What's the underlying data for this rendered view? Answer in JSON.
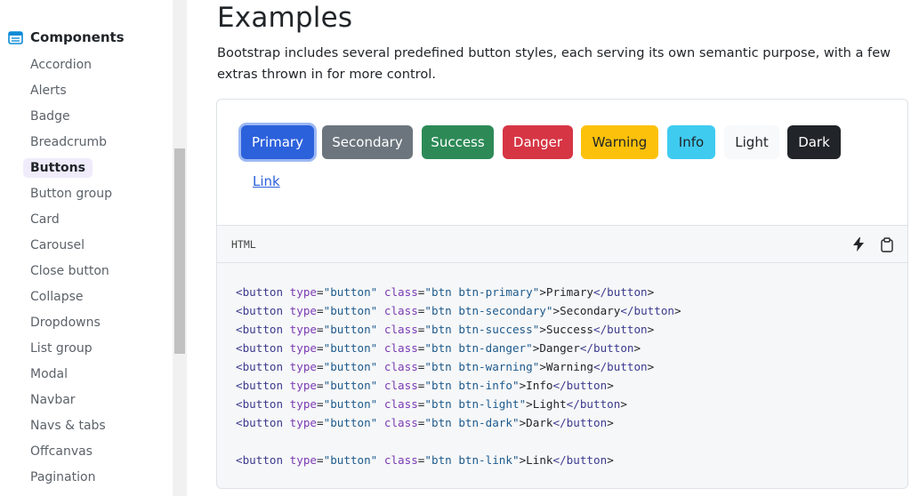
{
  "sidebar": {
    "section_title": "Components",
    "section_icon": "list-window-icon",
    "items": [
      {
        "label": "Accordion",
        "active": false
      },
      {
        "label": "Alerts",
        "active": false
      },
      {
        "label": "Badge",
        "active": false
      },
      {
        "label": "Breadcrumb",
        "active": false
      },
      {
        "label": "Buttons",
        "active": true
      },
      {
        "label": "Button group",
        "active": false
      },
      {
        "label": "Card",
        "active": false
      },
      {
        "label": "Carousel",
        "active": false
      },
      {
        "label": "Close button",
        "active": false
      },
      {
        "label": "Collapse",
        "active": false
      },
      {
        "label": "Dropdowns",
        "active": false
      },
      {
        "label": "List group",
        "active": false
      },
      {
        "label": "Modal",
        "active": false
      },
      {
        "label": "Navbar",
        "active": false
      },
      {
        "label": "Navs & tabs",
        "active": false
      },
      {
        "label": "Offcanvas",
        "active": false
      },
      {
        "label": "Pagination",
        "active": false
      }
    ]
  },
  "main": {
    "title": "Examples",
    "description": "Bootstrap includes several predefined button styles, each serving its own semantic purpose, with a few extras thrown in for more control."
  },
  "example": {
    "buttons": {
      "primary": "Primary",
      "secondary": "Secondary",
      "success": "Success",
      "danger": "Danger",
      "warning": "Warning",
      "info": "Info",
      "light": "Light",
      "dark": "Dark",
      "link": "Link"
    }
  },
  "code_block": {
    "language": "HTML",
    "icons": [
      "zap-icon",
      "clipboard-icon"
    ],
    "lines": [
      {
        "cls": "btn btn-primary",
        "text": "Primary"
      },
      {
        "cls": "btn btn-secondary",
        "text": "Secondary"
      },
      {
        "cls": "btn btn-success",
        "text": "Success"
      },
      {
        "cls": "btn btn-danger",
        "text": "Danger"
      },
      {
        "cls": "btn btn-warning",
        "text": "Warning"
      },
      {
        "cls": "btn btn-info",
        "text": "Info"
      },
      {
        "cls": "btn btn-light",
        "text": "Light"
      },
      {
        "cls": "btn btn-dark",
        "text": "Dark"
      },
      {
        "cls": "",
        "text": ""
      },
      {
        "cls": "btn btn-link",
        "text": "Link"
      }
    ]
  },
  "colors": {
    "primary": "#2c61dc",
    "secondary": "#6c757d",
    "success": "#2d8a57",
    "danger": "#d63544",
    "warning": "#fcc10a",
    "info": "#3fcbf0",
    "light": "#f8f9fa",
    "dark": "#212529",
    "sidebar_active_bg": "#f0ecfb"
  }
}
